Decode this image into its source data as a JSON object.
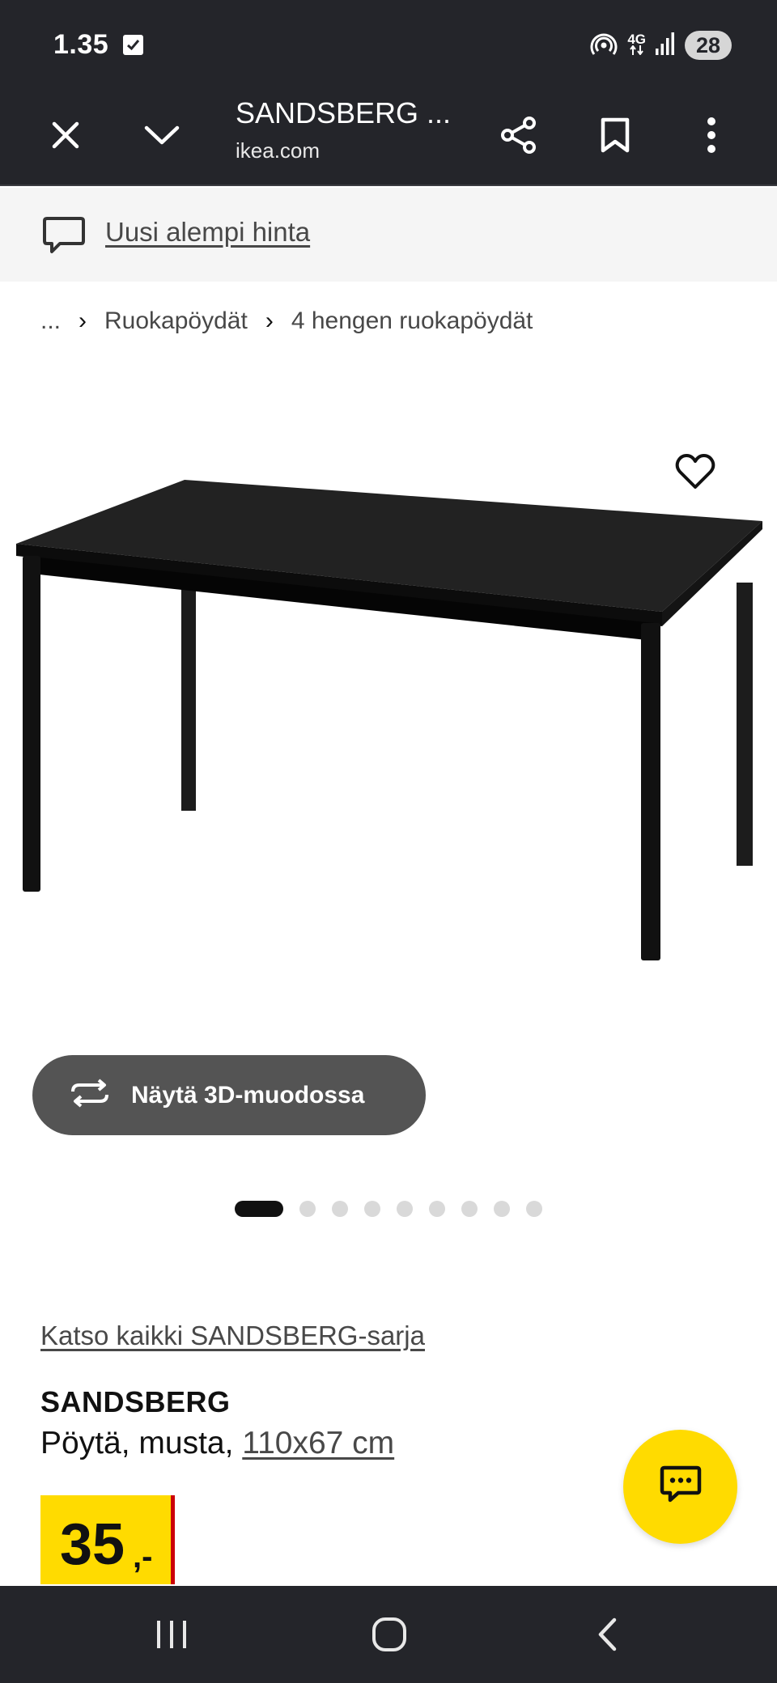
{
  "status_bar": {
    "time": "1.35",
    "network": "4G",
    "battery": "28",
    "icons": [
      "checkbox-notification-icon",
      "hotspot-icon",
      "network-4g-icon",
      "signal-icon"
    ]
  },
  "toolbar": {
    "title": "SANDSBERG ...",
    "url": "ikea.com",
    "icons": [
      "close-icon",
      "chevron-down-icon",
      "share-icon",
      "bookmark-icon",
      "more-vert-icon"
    ]
  },
  "banner": {
    "label": "Uusi alempi hinta",
    "icon": "speech-bubble-icon"
  },
  "breadcrumb": {
    "items": [
      "...",
      "Ruokapöydät",
      "4 hengen ruokapöydät"
    ],
    "separator": "›"
  },
  "product": {
    "view_3d_label": "Näytä 3D-muodossa",
    "carousel": {
      "total": 9,
      "active": 1
    },
    "series_link": "Katso kaikki SANDSBERG-sarja",
    "name": "SANDSBERG",
    "description": "Pöytä, musta,",
    "dimensions": "110x67 cm",
    "price": {
      "integer": "35",
      "suffix": ",-"
    }
  },
  "colors": {
    "toolbar_bg": "#24252a",
    "price_yellow": "#ffdb00",
    "price_red": "#cc0008",
    "button_gray": "#545454"
  }
}
